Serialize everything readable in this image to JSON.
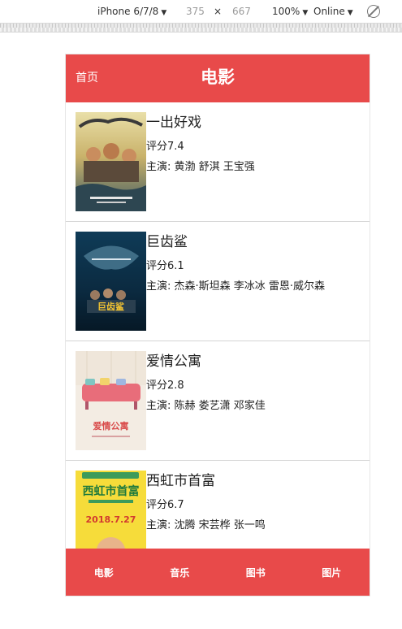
{
  "devtools": {
    "device": "iPhone 6/7/8",
    "width": "375",
    "times": "×",
    "height": "667",
    "zoom": "100%",
    "network": "Online",
    "arrow": "▼",
    "rotate_icon": "rotate-icon"
  },
  "header": {
    "home": "首页",
    "title": "电影"
  },
  "colors": {
    "accent": "#e84a4a"
  },
  "movies": [
    {
      "title": "一出好戏",
      "rating": "评分7.4",
      "cast": "主演: 黄渤 舒淇 王宝强"
    },
    {
      "title": "巨齿鲨",
      "rating": "评分6.1",
      "cast": "主演: 杰森·斯坦森 李冰冰 雷恩·威尔森"
    },
    {
      "title": "爱情公寓",
      "rating": "评分2.8",
      "cast": "主演: 陈赫 娄艺潇 邓家佳"
    },
    {
      "title": "西虹市首富",
      "rating": "评分6.7",
      "cast": "主演: 沈腾 宋芸桦 张一鸣"
    }
  ],
  "poster_text": {
    "p2": "巨齿鲨",
    "p3": "爱情公寓",
    "p4": "西虹市首富",
    "p4_date": "2018.7.27"
  },
  "tabs": [
    {
      "label": "电影"
    },
    {
      "label": "音乐"
    },
    {
      "label": "图书"
    },
    {
      "label": "图片"
    }
  ]
}
